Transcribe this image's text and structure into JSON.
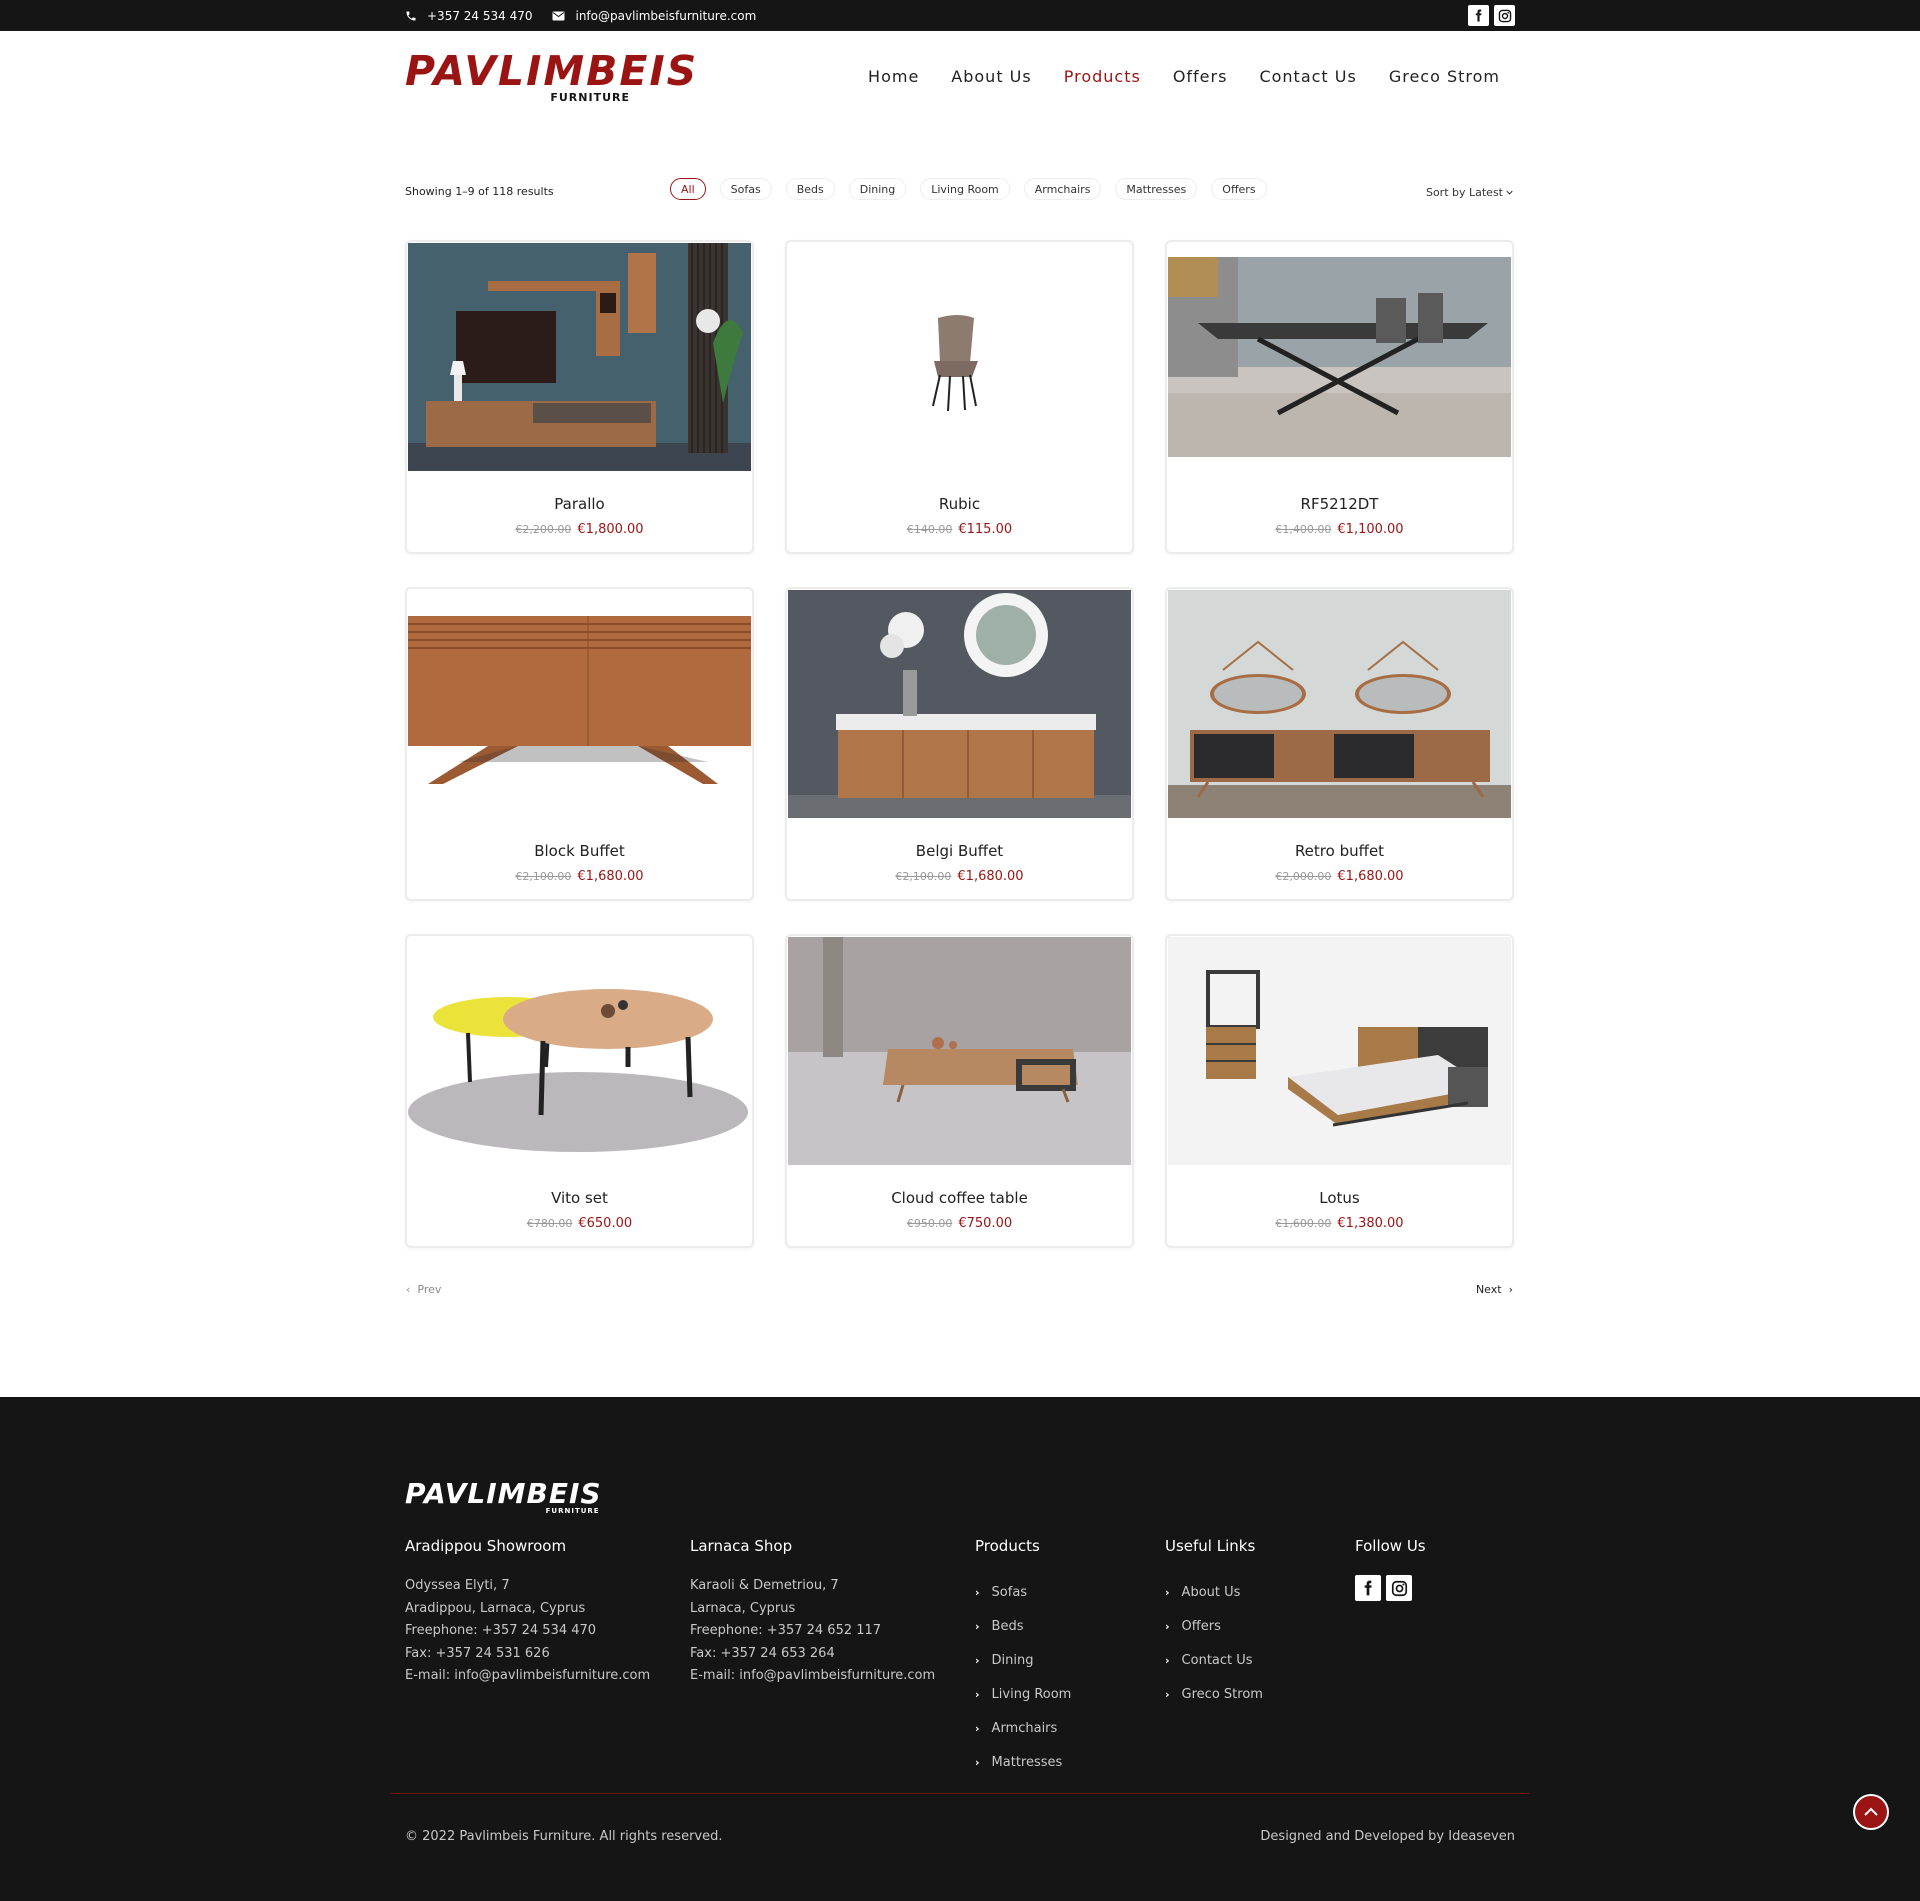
{
  "topbar": {
    "phone": "+357 24 534 470",
    "email": "info@pavlimbeisfurniture.com"
  },
  "header": {
    "logo_main": "PAVLIMBEIS",
    "logo_sub": "FURNITURE",
    "nav": [
      "Home",
      "About Us",
      "Products",
      "Offers",
      "Contact Us",
      "Greco Strom"
    ],
    "active_nav": "Products"
  },
  "toolbar": {
    "results_text": "Showing 1–9 of 118 results",
    "filters": [
      "All",
      "Sofas",
      "Beds",
      "Dining",
      "Living Room",
      "Armchairs",
      "Mattresses",
      "Offers"
    ],
    "active_filter": "All",
    "sort_label": "Sort by Latest"
  },
  "products": [
    {
      "name": "Parallo",
      "old_price": "€2,200.00",
      "price": "€1,800.00"
    },
    {
      "name": "Rubic",
      "old_price": "€140.00",
      "price": "€115.00"
    },
    {
      "name": "RF5212DT",
      "old_price": "€1,400.00",
      "price": "€1,100.00"
    },
    {
      "name": "Block Buffet",
      "old_price": "€2,100.00",
      "price": "€1,680.00"
    },
    {
      "name": "Belgi Buffet",
      "old_price": "€2,100.00",
      "price": "€1,680.00"
    },
    {
      "name": "Retro buffet",
      "old_price": "€2,000.00",
      "price": "€1,680.00"
    },
    {
      "name": "Vito set",
      "old_price": "€780.00",
      "price": "€650.00"
    },
    {
      "name": "Cloud coffee table",
      "old_price": "€950.00",
      "price": "€750.00"
    },
    {
      "name": "Lotus",
      "old_price": "€1,600.00",
      "price": "€1,380.00"
    }
  ],
  "pagination": {
    "prev": "Prev",
    "next": "Next"
  },
  "footer": {
    "logo_main": "PAVLIMBEIS",
    "logo_sub": "FURNITURE",
    "showroom": {
      "title": "Aradippou Showroom",
      "lines": [
        "Odyssea Elyti, 7",
        "Aradippou, Larnaca, Cyprus",
        "Freephone: +357 24 534 470",
        "Fax: +357 24 531 626",
        "E-mail: info@pavlimbeisfurniture.com"
      ]
    },
    "shop": {
      "title": "Larnaca Shop",
      "lines": [
        "Karaoli & Demetriou, 7",
        "Larnaca, Cyprus",
        "Freephone: +357 24 652 117",
        "Fax: +357 24 653 264",
        "E-mail: info@pavlimbeisfurniture.com"
      ]
    },
    "products": {
      "title": "Products",
      "links": [
        "Sofas",
        "Beds",
        "Dining",
        "Living Room",
        "Armchairs",
        "Mattresses"
      ]
    },
    "useful": {
      "title": "Useful Links",
      "links": [
        "About Us",
        "Offers",
        "Contact Us",
        "Greco Strom"
      ]
    },
    "follow": {
      "title": "Follow Us"
    },
    "copyright": "© 2022 Pavlimbeis Furniture. All rights reserved.",
    "credit": "Designed and Developed by Ideaseven"
  },
  "colors": {
    "brand": "#9b1414",
    "dark": "#151515"
  },
  "icons": [
    "phone-icon",
    "mail-icon",
    "facebook-icon",
    "instagram-icon",
    "chevron-down-icon",
    "chevron-left-icon",
    "chevron-right-icon",
    "arrow-up-icon"
  ]
}
